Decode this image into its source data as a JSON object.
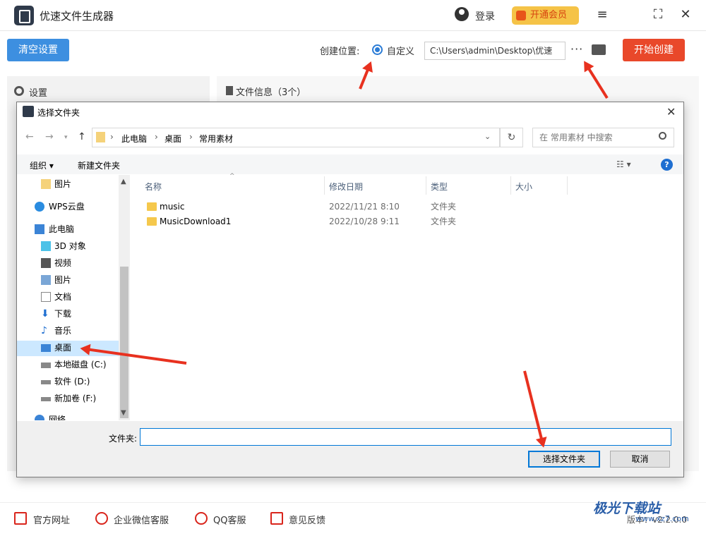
{
  "app": {
    "title": "优速文件生成器",
    "login": "登录",
    "vip": "开通会员",
    "window_controls": [
      "menu-icon",
      "maximize-icon",
      "close-icon"
    ]
  },
  "toolbar": {
    "clear_label": "清空设置",
    "location_label": "创建位置:",
    "radio_label": "自定义",
    "path_value": "C:\\Users\\admin\\Desktop\\优速",
    "more_label": "···",
    "start_label": "开始创建"
  },
  "panels": {
    "settings_title": "设置",
    "fileinfo_title": "文件信息（3个）"
  },
  "footer": {
    "links": [
      "官方网址",
      "企业微信客服",
      "QQ客服",
      "意见反馈"
    ],
    "version": "版本：v2.2.0.0",
    "watermark": "极光下载站",
    "watermark_url": "www.xz7.com"
  },
  "dialog": {
    "title": "选择文件夹",
    "breadcrumb": [
      "此电脑",
      "桌面",
      "常用素材"
    ],
    "search_placeholder": "在 常用素材 中搜索",
    "organize": "组织 ▾",
    "new_folder": "新建文件夹",
    "nav_items": [
      {
        "label": "图片",
        "icon": "folder-icon"
      },
      {
        "label": "WPS云盘",
        "icon": "cloud-icon"
      },
      {
        "label": "此电脑",
        "icon": "pc-icon"
      },
      {
        "label": "3D 对象",
        "icon": "cube-icon"
      },
      {
        "label": "视频",
        "icon": "video-icon"
      },
      {
        "label": "图片",
        "icon": "image-icon"
      },
      {
        "label": "文档",
        "icon": "document-icon"
      },
      {
        "label": "下载",
        "icon": "download-icon"
      },
      {
        "label": "音乐",
        "icon": "music-icon"
      },
      {
        "label": "桌面",
        "icon": "desktop-icon"
      },
      {
        "label": "本地磁盘 (C:)",
        "icon": "drive-icon"
      },
      {
        "label": "软件 (D:)",
        "icon": "drive-icon"
      },
      {
        "label": "新加卷 (F:)",
        "icon": "drive-icon"
      },
      {
        "label": "网络",
        "icon": "network-icon"
      }
    ],
    "columns": [
      "名称",
      "修改日期",
      "类型",
      "大小"
    ],
    "rows": [
      {
        "name": "music",
        "date": "2022/11/21 8:10",
        "type": "文件夹"
      },
      {
        "name": "MusicDownload1",
        "date": "2022/10/28 9:11",
        "type": "文件夹"
      }
    ],
    "folder_label": "文件夹:",
    "folder_value": "",
    "select_label": "选择文件夹",
    "cancel_label": "取消"
  },
  "colors": {
    "accent_blue": "#3d8fe0",
    "start_red": "#e9482a",
    "vip_yellow": "#f5c347",
    "arrow_red": "#e8311f",
    "selection": "#cce8ff"
  }
}
